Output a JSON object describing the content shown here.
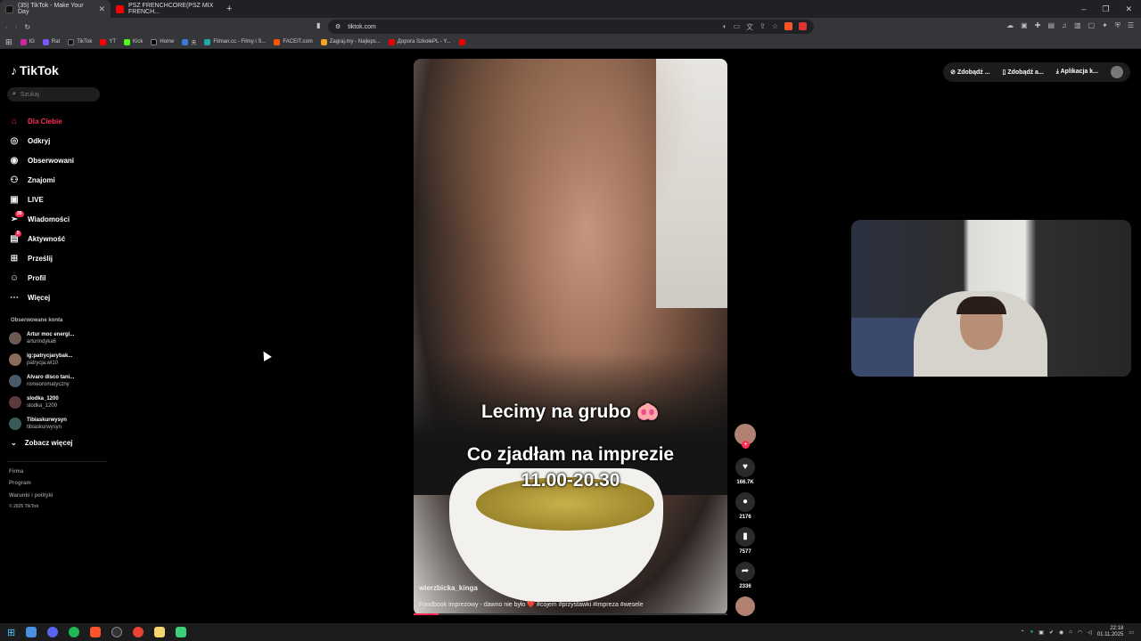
{
  "browser": {
    "tabs": [
      {
        "label": "(35) TikTok - Make Your Day",
        "active": true
      },
      {
        "label": "PSZ FRENCHCORE(PSZ MIX FRENCH...",
        "active": false
      }
    ],
    "url": "tiktok.com",
    "bookmarks": [
      "IG",
      "Rat",
      "TikTok",
      "YT",
      "Kick",
      "Home",
      "天",
      "Filman.cc - Filmy i S...",
      "FACEIT.com",
      "Zagraj.my - Najleps...",
      "Дорога SzkołePL - Y..."
    ]
  },
  "sidebar": {
    "logo": "TikTok",
    "search_placeholder": "Szukaj",
    "nav": [
      {
        "label": "Dla Ciebie",
        "icon": "home-icon",
        "active": true
      },
      {
        "label": "Odkryj",
        "icon": "compass-icon"
      },
      {
        "label": "Obserwowani",
        "icon": "following-icon"
      },
      {
        "label": "Znajomi",
        "icon": "friends-icon"
      },
      {
        "label": "LIVE",
        "icon": "live-icon"
      },
      {
        "label": "Wiadomości",
        "icon": "send-icon",
        "badge": "35"
      },
      {
        "label": "Aktywność",
        "icon": "activity-icon",
        "badge": "5"
      },
      {
        "label": "Prześlij",
        "icon": "upload-icon"
      },
      {
        "label": "Profil",
        "icon": "profile-icon"
      },
      {
        "label": "Więcej",
        "icon": "more-icon"
      }
    ],
    "followed_title": "Obserwowane konta",
    "followed": [
      {
        "name": "Artur moc energi...",
        "username": "arturindyka6"
      },
      {
        "name": "ig:patrycjarybak...",
        "username": "patrycja.wl10"
      },
      {
        "name": "Alvaro disco tani...",
        "username": "romeoromatyczny"
      },
      {
        "name": "slodka_1200",
        "username": "slodka_1200"
      },
      {
        "name": "Tibiaskurwysyn",
        "username": "tibiaskurwysyn"
      }
    ],
    "see_more": "Zobacz więcej",
    "footer": [
      "Firma",
      "Program",
      "Warunki i polityki",
      "© 2025 TikTok"
    ]
  },
  "video": {
    "overlay_1": "Lecimy na grubo 🐽",
    "overlay_2": "Co zjadłam na imprezie",
    "overlay_3": "11.00-20.30",
    "author": "wierzbicka_kinga",
    "description": "Foodbook imprezowy - dawno nie było ❤️ #cojem #przystawki #impreza #wesele",
    "progress": 0.08
  },
  "actions": {
    "likes": "166.7K",
    "comments": "2176",
    "saves": "7577",
    "shares": "2336"
  },
  "top_buttons": [
    "Zdobądź ...",
    "Zdobądź a...",
    "Aplikacja k..."
  ],
  "taskbar": {
    "time": "22:18",
    "date": "01.11.2025"
  }
}
